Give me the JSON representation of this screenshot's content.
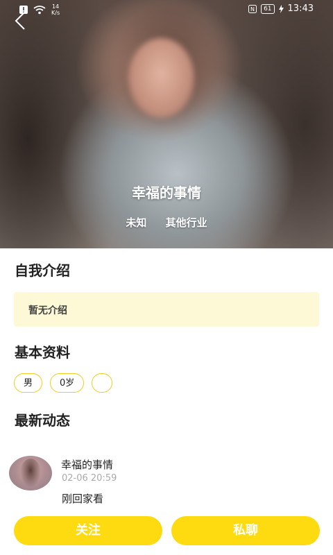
{
  "status_bar": {
    "net_speed_value": "14",
    "net_speed_unit": "K/s",
    "battery": "61",
    "time": "13:43"
  },
  "profile": {
    "name": "幸福的事情",
    "gender_status": "未知",
    "industry": "其他行业"
  },
  "sections": {
    "intro_title": "自我介绍",
    "intro_text": "暂无介绍",
    "basic_title": "基本资料",
    "feed_title": "最新动态"
  },
  "tags": [
    "男",
    "0岁",
    ""
  ],
  "post": {
    "user": "幸福的事情",
    "time": "02-06 20:59",
    "text": "刚回家看"
  },
  "actions": {
    "follow": "关注",
    "message": "私聊"
  },
  "colors": {
    "accent": "#FEDB11",
    "intro_bg": "#FDF8D6"
  }
}
